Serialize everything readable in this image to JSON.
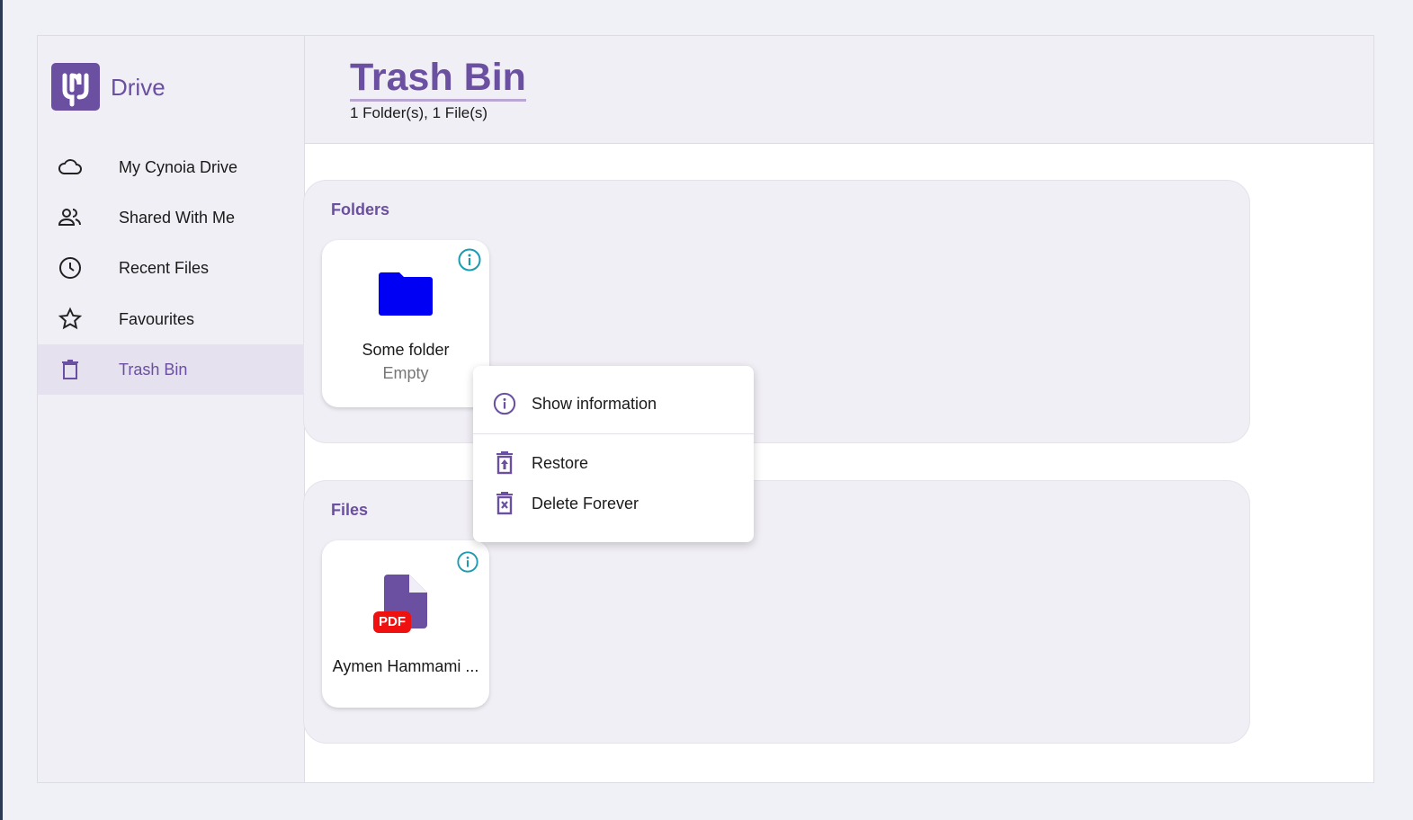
{
  "sidebar": {
    "brand": "Drive",
    "items": [
      {
        "label": "My Cynoia Drive",
        "icon": "cloud-icon"
      },
      {
        "label": "Shared With Me",
        "icon": "people-icon"
      },
      {
        "label": "Recent Files",
        "icon": "clock-icon"
      },
      {
        "label": "Favourites",
        "icon": "star-icon"
      },
      {
        "label": "Trash Bin",
        "icon": "trash-icon",
        "active": true
      }
    ]
  },
  "header": {
    "title": "Trash Bin",
    "subtitle": "1 Folder(s), 1 File(s)"
  },
  "folders": {
    "title": "Folders",
    "items": [
      {
        "name": "Some folder",
        "status": "Empty"
      }
    ]
  },
  "files": {
    "title": "Files",
    "items": [
      {
        "name": "Aymen Hammami ...",
        "type": "PDF"
      }
    ]
  },
  "context_menu": {
    "items": [
      {
        "label": "Show information"
      },
      {
        "label": "Restore"
      },
      {
        "label": "Delete Forever"
      }
    ]
  },
  "colors": {
    "accent": "#6b4fa0",
    "folder": "#0000f5",
    "pdf": "#f01010",
    "info": "#1a9bb0"
  }
}
